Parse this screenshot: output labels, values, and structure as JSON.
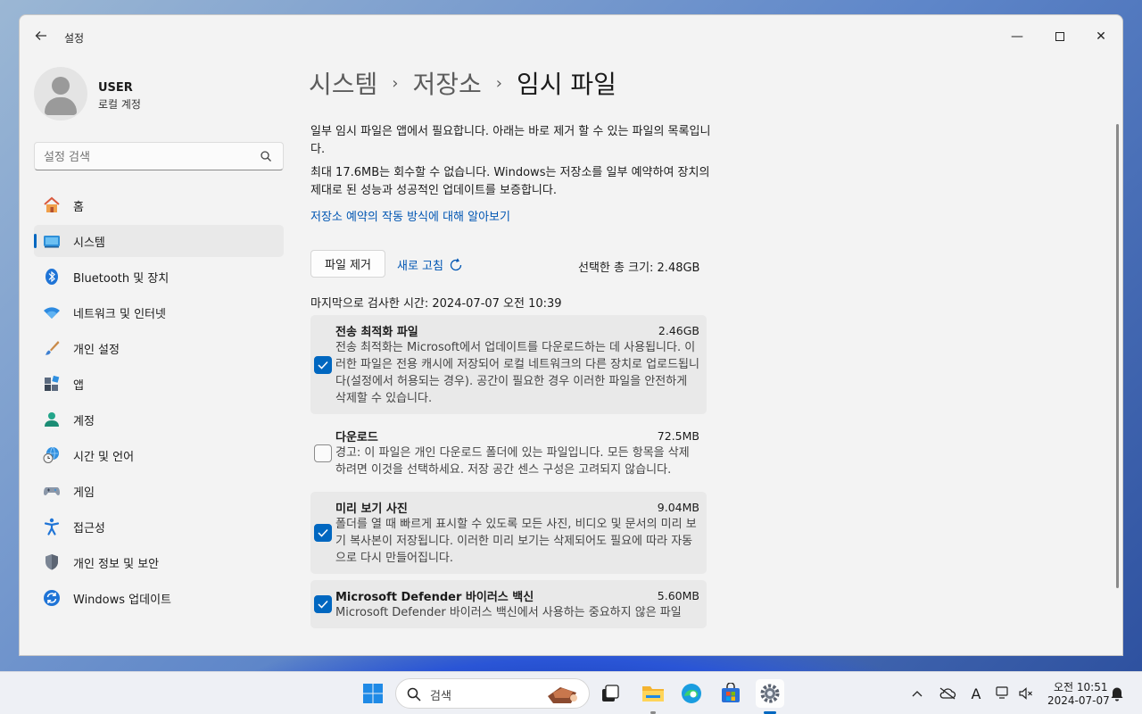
{
  "window": {
    "app_title": "설정",
    "controls": {
      "minimize": "—",
      "close": "✕"
    }
  },
  "profile": {
    "name": "USER",
    "account_type": "로컬 계정"
  },
  "search": {
    "placeholder": "설정 검색"
  },
  "nav": {
    "items": [
      {
        "label": "홈",
        "icon": "home-icon"
      },
      {
        "label": "시스템",
        "icon": "system-icon",
        "active": true
      },
      {
        "label": "Bluetooth 및 장치",
        "icon": "bluetooth-icon"
      },
      {
        "label": "네트워크 및 인터넷",
        "icon": "wifi-icon"
      },
      {
        "label": "개인 설정",
        "icon": "paintbrush-icon"
      },
      {
        "label": "앱",
        "icon": "apps-icon"
      },
      {
        "label": "계정",
        "icon": "account-icon"
      },
      {
        "label": "시간 및 언어",
        "icon": "globe-clock-icon"
      },
      {
        "label": "게임",
        "icon": "gamepad-icon"
      },
      {
        "label": "접근성",
        "icon": "accessibility-icon"
      },
      {
        "label": "개인 정보 및 보안",
        "icon": "shield-icon"
      },
      {
        "label": "Windows 업데이트",
        "icon": "update-icon"
      }
    ]
  },
  "breadcrumb": {
    "level1": "시스템",
    "level2": "저장소",
    "current": "임시 파일",
    "separator": "›"
  },
  "content": {
    "desc1": "일부 임시 파일은 앱에서 필요합니다. 아래는 바로 제거 할 수 있는 파일의 목록입니다.",
    "desc2": "최대 17.6MB는 회수할 수 없습니다. Windows는 저장소를 일부 예약하여 장치의 제대로 된 성능과 성공적인 업데이트를 보증합니다.",
    "learn_link": "저장소 예약의 작동 방식에 대해 알아보기",
    "remove_button": "파일 제거",
    "refresh_link": "새로 고침",
    "total_size": "선택한 총 크기: 2.48GB",
    "last_scan": "마지막으로 검사한 시간: 2024-07-07 오전 10:39",
    "items": [
      {
        "title": "전송 최적화 파일",
        "size": "2.46GB",
        "desc": "전송 최적화는 Microsoft에서 업데이트를 다운로드하는 데 사용됩니다. 이러한 파일은 전용 캐시에 저장되어 로컬 네트워크의 다른 장치로 업로드됩니다(설정에서 허용되는 경우). 공간이 필요한 경우 이러한 파일을 안전하게 삭제할 수 있습니다.",
        "checked": true
      },
      {
        "title": "다운로드",
        "size": "72.5MB",
        "desc": "경고: 이 파일은 개인 다운로드 폴더에 있는 파일입니다. 모든 항목을 삭제하려면 이것을 선택하세요. 저장 공간 센스 구성은 고려되지 않습니다.",
        "checked": false
      },
      {
        "title": "미리 보기 사진",
        "size": "9.04MB",
        "desc": "폴더를 열 때 빠르게 표시할 수 있도록 모든 사진, 비디오 및 문서의 미리 보기 복사본이 저장됩니다. 이러한 미리 보기는 삭제되어도 필요에 따라 자동으로 다시 만들어집니다.",
        "checked": true
      },
      {
        "title": "Microsoft Defender 바이러스 백신",
        "size": "5.60MB",
        "desc": "Microsoft Defender 바이러스 백신에서 사용하는 중요하지 않은 파일",
        "checked": true
      }
    ]
  },
  "taskbar": {
    "search_label": "검색",
    "clock_time": "오전 10:51",
    "clock_date": "2024-07-07",
    "tray_text_icon": "A"
  },
  "colors": {
    "accent": "#0067c0",
    "link": "#0056b3"
  }
}
